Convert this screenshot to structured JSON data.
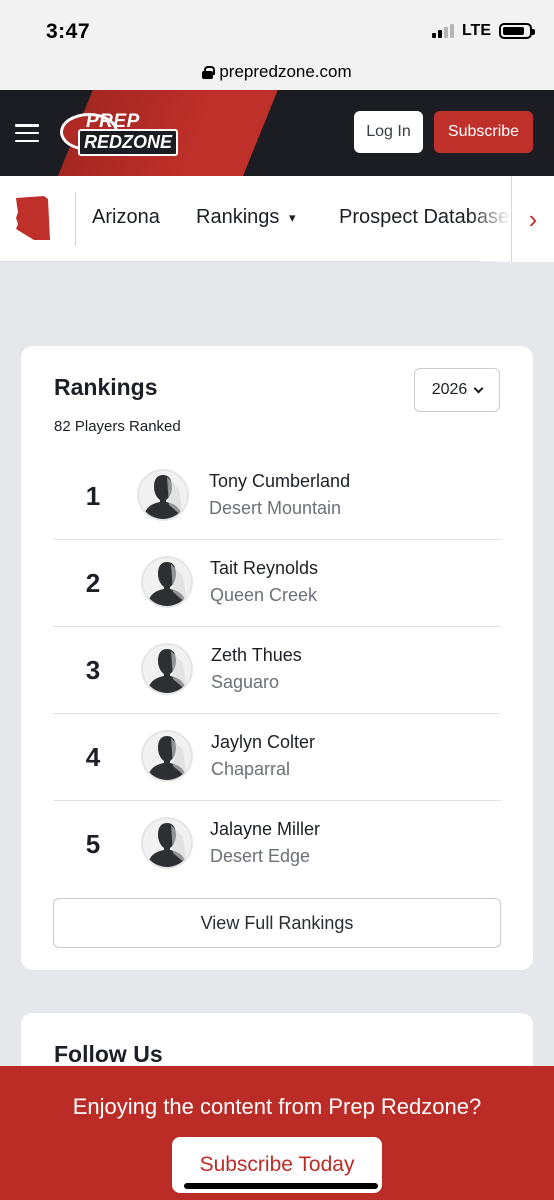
{
  "status_bar": {
    "time": "3:47",
    "network": "LTE"
  },
  "browser": {
    "url": "prepredzone.com"
  },
  "header": {
    "logo_top": "PREP",
    "logo_bottom": "REDZONE",
    "login_label": "Log In",
    "subscribe_label": "Subscribe",
    "brand_color": "#c0302a"
  },
  "state_nav": {
    "items": [
      {
        "label": "Arizona"
      },
      {
        "label": "Rankings",
        "chevron": "▾"
      },
      {
        "label": "Prospect Database"
      }
    ],
    "scroll_arrow": "›"
  },
  "rankings": {
    "title": "Rankings",
    "count_text": "82 Players Ranked",
    "year": "2026",
    "players": [
      {
        "rank": "1",
        "name": "Tony Cumberland",
        "school": "Desert Mountain"
      },
      {
        "rank": "2",
        "name": "Tait Reynolds",
        "school": "Queen Creek"
      },
      {
        "rank": "3",
        "name": "Zeth Thues",
        "school": "Saguaro"
      },
      {
        "rank": "4",
        "name": "Jaylyn Colter",
        "school": "Chaparral"
      },
      {
        "rank": "5",
        "name": "Jalayne Miller",
        "school": "Desert Edge"
      }
    ],
    "view_full_label": "View Full Rankings"
  },
  "follow": {
    "title": "Follow Us"
  },
  "banner": {
    "text": "Enjoying the content from Prep Redzone?",
    "button_label": "Subscribe Today"
  }
}
